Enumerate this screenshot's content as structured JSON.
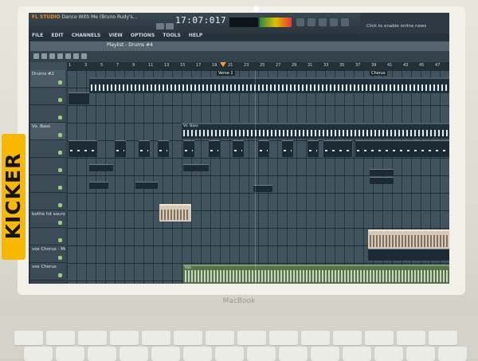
{
  "device": {
    "brand_label": "MacBook",
    "sticker_text": "KICKER"
  },
  "app": {
    "logo": "FL STUDIO",
    "project_title": "Dance With Me (Bruno Rudy's..."
  },
  "menu": [
    "FILE",
    "EDIT",
    "CHANNELS",
    "VIEW",
    "OPTIONS",
    "TOOLS",
    "HELP"
  ],
  "transport": {
    "clock": "17:07:017"
  },
  "toolbar": {
    "online_news": "Click to enable online news"
  },
  "playlist": {
    "title": "Playlist - Drums #4",
    "timeline_bars": [
      "1",
      "3",
      "5",
      "7",
      "9",
      "11",
      "13",
      "15",
      "17",
      "19",
      "21",
      "23",
      "25",
      "27",
      "29",
      "31",
      "33",
      "35",
      "37",
      "39",
      "41",
      "43",
      "45",
      "47"
    ],
    "markers": {
      "verse": "Verse 1",
      "chorus": "Chorus"
    },
    "tracks": [
      {
        "name": "Drums #2"
      },
      {
        "name": ""
      },
      {
        "name": ""
      },
      {
        "name": "Vs. Bass"
      },
      {
        "name": ""
      },
      {
        "name": ""
      },
      {
        "name": ""
      },
      {
        "name": ""
      },
      {
        "name": ""
      },
      {
        "name": "bottle hit sound"
      },
      {
        "name": ""
      },
      {
        "name": "vox Chorus - Med"
      },
      {
        "name": "vox Chorus"
      },
      {
        "name": ""
      }
    ],
    "clip_labels": {
      "vs_bass": "Vs. Bass",
      "audio_vocal": "Vox"
    }
  },
  "colors": {
    "logo": "#f08a24",
    "screen_bg": "#26333b",
    "audio_clip": "#55724a",
    "playhead": "#f0a030"
  }
}
